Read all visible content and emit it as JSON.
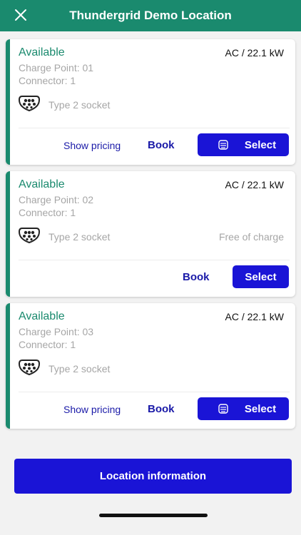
{
  "header": {
    "title": "Thundergrid Demo Location",
    "close_icon": "close-icon",
    "background": "#1a8a6e"
  },
  "connectors": [
    {
      "status": "Available",
      "power": "AC / 22.1 kW",
      "charge_point": "Charge Point: 01",
      "connector": "Connector: 1",
      "socket_type": "Type 2 socket",
      "price_note": "",
      "show_pricing": "Show pricing",
      "book": "Book",
      "select": "Select"
    },
    {
      "status": "Available",
      "power": "AC / 22.1 kW",
      "charge_point": "Charge Point: 02",
      "connector": "Connector: 1",
      "socket_type": "Type 2 socket",
      "price_note": "Free of charge",
      "show_pricing": "",
      "book": "Book",
      "select": "Select"
    },
    {
      "status": "Available",
      "power": "AC / 22.1 kW",
      "charge_point": "Charge Point: 03",
      "connector": "Connector: 1",
      "socket_type": "Type 2 socket",
      "price_note": "",
      "show_pricing": "Show pricing",
      "book": "Book",
      "select": "Select"
    }
  ],
  "footer": {
    "location_information": "Location information"
  },
  "colors": {
    "accent_green": "#1a8a6e",
    "primary_blue": "#1a14d6",
    "link_blue": "#1a1aa8",
    "muted_text": "#a6a6a6"
  }
}
